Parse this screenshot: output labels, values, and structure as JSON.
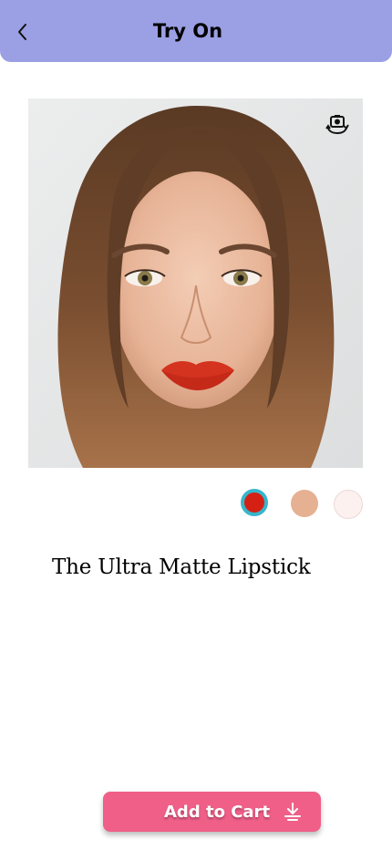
{
  "header": {
    "title": "Try On",
    "back_icon": "chevron-left-icon",
    "background": "#9b9fe3"
  },
  "preview": {
    "flip_camera_icon": "camera-flip-icon"
  },
  "shades": [
    {
      "name": "red",
      "color": "#d42114",
      "selected": true
    },
    {
      "name": "nude",
      "color": "#e6b092",
      "selected": false
    },
    {
      "name": "light-pink",
      "color": "#fdf1ef",
      "selected": false
    }
  ],
  "product": {
    "name": "The Ultra Matte Lipstick"
  },
  "cart": {
    "label": "Add to Cart",
    "icon": "download-icon",
    "color": "#ef5f88"
  }
}
